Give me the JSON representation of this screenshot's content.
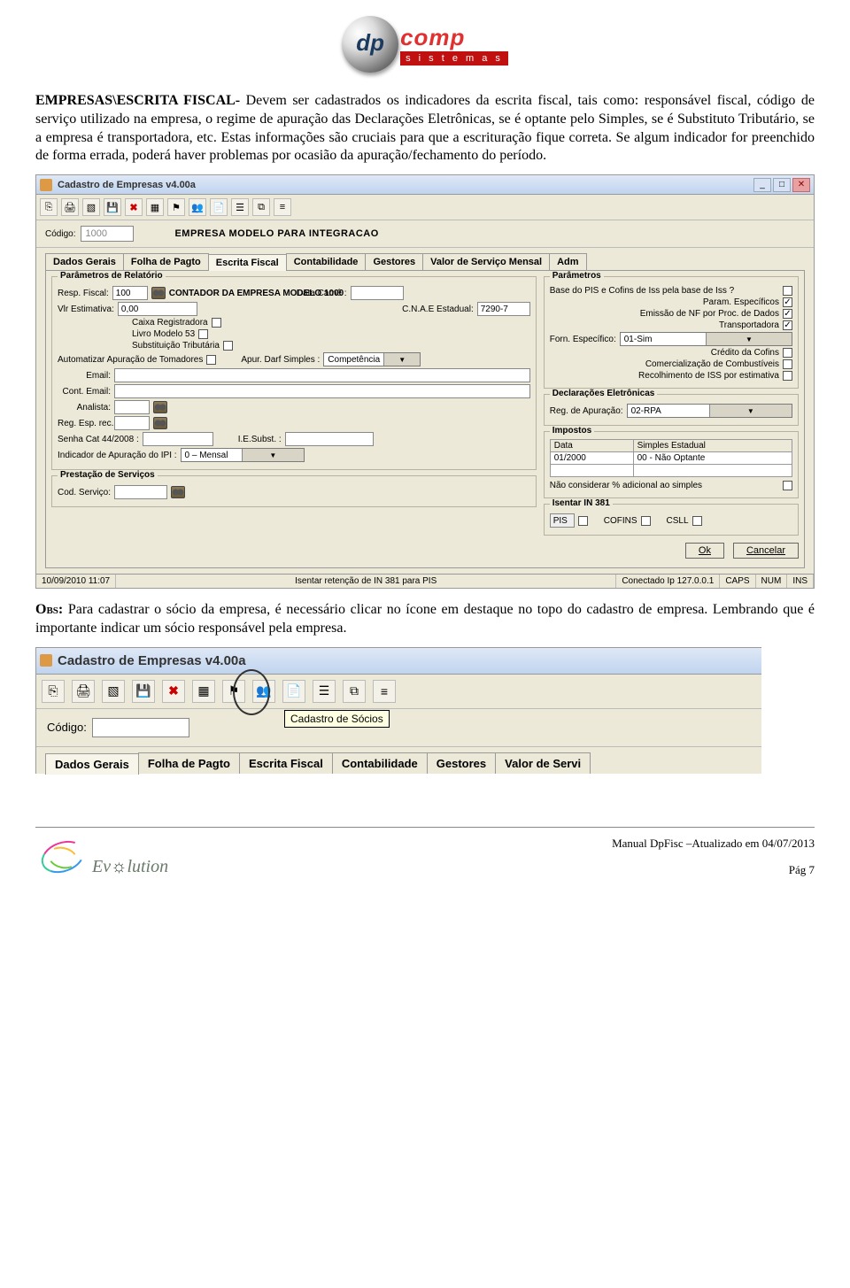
{
  "logo": {
    "dp": "dp",
    "comp": "comp",
    "sist": "s i s t e m a s"
  },
  "para1": {
    "lead": "EMPRESAS\\ESCRITA FISCAL- ",
    "body": "Devem ser cadastrados os indicadores da escrita fiscal, tais como: responsável fiscal, código de serviço utilizado na empresa, o regime de apuração das Declarações Eletrônicas, se é optante pelo Simples, se é Substituto Tributário, se a empresa é transportadora, etc. Estas informações são cruciais para que a escrituração fique correta.  Se algum indicador for preenchido de forma errada, poderá haver problemas por ocasião da apuração/fechamento do período."
  },
  "win1": {
    "title": "Cadastro de Empresas          v4.00a",
    "codigo_lbl": "Código:",
    "codigo_val": "1000",
    "empresa": "EMPRESA MODELO PARA INTEGRACAO",
    "tabs": [
      "Dados Gerais",
      "Folha de Pagto",
      "Escrita Fiscal",
      "Contabilidade",
      "Gestores",
      "Valor de Serviço Mensal",
      "Adm"
    ],
    "grp_param": "Parâmetros de Relatório",
    "resp_fiscal_lbl": "Resp. Fiscal:",
    "resp_fiscal_val": "100",
    "contador": "CONTADOR DA EMPRESA MODELO 1000",
    "data_carne_lbl": "Data Carnê :",
    "vlr_est_lbl": "Vlr Estimativa:",
    "vlr_est_val": "0,00",
    "cnae_lbl": "C.N.A.E Estadual:",
    "cnae_val": "7290-7",
    "caixa_lbl": "Caixa Registradora",
    "livro_lbl": "Livro Modelo 53",
    "subst_lbl": "Substituição Tributária",
    "autom_lbl": "Automatizar Apuração de Tomadores",
    "apur_darf_lbl": "Apur. Darf Simples :",
    "apur_darf_val": "Competência",
    "email_lbl": "Email:",
    "contemail_lbl": "Cont. Email:",
    "analista_lbl": "Analista:",
    "regesp_lbl": "Reg. Esp. rec.ISS:",
    "senha_lbl": "Senha Cat 44/2008 :",
    "iesubst_lbl": "I.E.Subst. :",
    "indic_ipi_lbl": "Indicador de Apuração do IPI :",
    "indic_ipi_val": "0 – Mensal",
    "grp_prest": "Prestação de Serviços",
    "codserv_lbl": "Cod. Serviço:",
    "grp_paramR": "Parâmetros",
    "base_pis_lbl": "Base do PIS e Cofins de Iss pela base de Iss ?",
    "param_esp_lbl": "Param. Específicos",
    "emiss_nf_lbl": "Emissão de NF por Proc. de Dados",
    "transp_lbl": "Transportadora",
    "forn_esp_lbl": "Forn. Específico:",
    "forn_esp_val": "01-Sim",
    "cred_cof_lbl": "Crédito da Cofins",
    "comb_lbl": "Comercialização de Combustíveis",
    "recol_iss_lbl": "Recolhimento de ISS por estimativa",
    "grp_decl": "Declarações Eletrônicas",
    "reg_apur_lbl": "Reg. de Apuração:",
    "reg_apur_val": "02-RPA",
    "grp_imp": "Impostos",
    "imp_h1": "Data",
    "imp_h2": "Simples Estadual",
    "imp_d1": "01/2000",
    "imp_d2": "00 - Não Optante",
    "nao_cons_lbl": "Não considerar % adicional ao simples",
    "grp_isent": "Isentar IN 381",
    "pis": "PIS",
    "cofins": "COFINS",
    "csll": "CSLL",
    "ok": "Ok",
    "cancel": "Cancelar",
    "status_dt": "10/09/2010  11:07",
    "status_mid": "Isentar retenção de IN 381 para PIS",
    "status_ip": "Conectado Ip 127.0.0.1",
    "caps": "CAPS",
    "num": "NUM",
    "ins": "INS"
  },
  "para2": {
    "obs": "Obs: ",
    "body": "Para cadastrar o sócio da empresa, é necessário clicar no ícone em destaque no topo do cadastro de empresa. Lembrando que é importante indicar um sócio responsável pela empresa."
  },
  "win2": {
    "title": "Cadastro de Empresas              v4.00a",
    "tooltip": "Cadastro de Sócios",
    "codigo_lbl": "Código:",
    "tabs": [
      "Dados Gerais",
      "Folha de Pagto",
      "Escrita Fiscal",
      "Contabilidade",
      "Gestores",
      "Valor de Servi"
    ]
  },
  "footer": {
    "evo1": "Ev",
    "evo2": "lution",
    "manual": "Manual DpFisc –Atualizado em  04/07/2013",
    "pag": "Pág 7"
  }
}
